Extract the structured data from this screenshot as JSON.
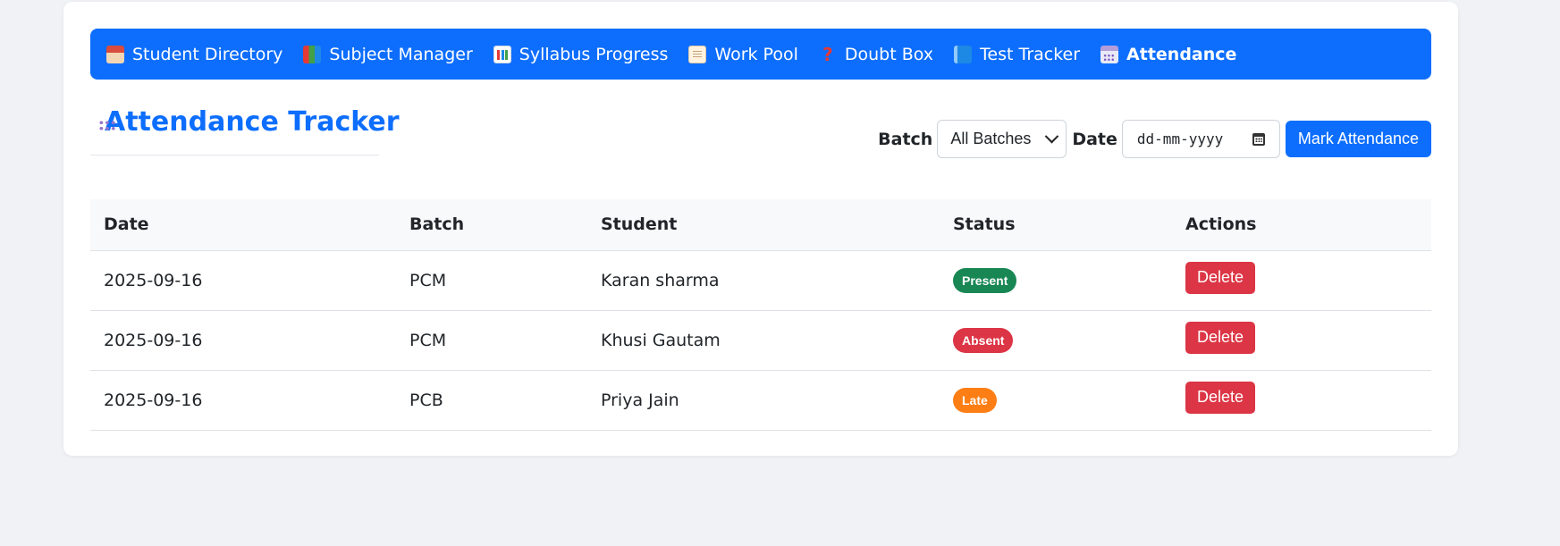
{
  "nav": {
    "items": [
      {
        "label": "Student Directory",
        "icon": "school-icon"
      },
      {
        "label": "Subject Manager",
        "icon": "books-icon"
      },
      {
        "label": "Syllabus Progress",
        "icon": "bar-chart-icon"
      },
      {
        "label": "Work Pool",
        "icon": "memo-icon"
      },
      {
        "label": "Doubt Box",
        "icon": "question-mark-icon"
      },
      {
        "label": "Test Tracker",
        "icon": "blue-book-icon"
      },
      {
        "label": "Attendance",
        "icon": "calendar-icon",
        "active": true
      }
    ]
  },
  "page": {
    "title": "Attendance Tracker",
    "title_icon": "calendar-icon",
    "accent_color": "#0d6efd"
  },
  "controls": {
    "batch_label": "Batch",
    "batch_value": "All Batches",
    "date_label": "Date",
    "date_placeholder": "dd-mm-yyyy",
    "mark_button": "Mark Attendance"
  },
  "table": {
    "headers": [
      "Date",
      "Batch",
      "Student",
      "Status",
      "Actions"
    ],
    "rows": [
      {
        "date": "2025-09-16",
        "batch": "PCM",
        "student": "Karan sharma",
        "status": "Present",
        "status_color": "#198754",
        "action": "Delete"
      },
      {
        "date": "2025-09-16",
        "batch": "PCM",
        "student": "Khusi Gautam",
        "status": "Absent",
        "status_color": "#dc3545",
        "action": "Delete"
      },
      {
        "date": "2025-09-16",
        "batch": "PCB",
        "student": "Priya Jain",
        "status": "Late",
        "status_color": "#fd7e14",
        "action": "Delete"
      }
    ]
  }
}
